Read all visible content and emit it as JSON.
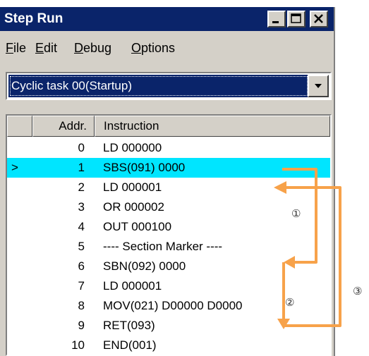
{
  "window": {
    "title": "Step Run",
    "controls": [
      "minimize",
      "maximize",
      "close"
    ]
  },
  "menu": [
    {
      "label": "File",
      "underline": "F",
      "rest": "ile"
    },
    {
      "label": "Edit",
      "underline": "E",
      "rest": "dit"
    },
    {
      "label": "Debug",
      "underline": "D",
      "rest": "ebug"
    },
    {
      "label": "Options",
      "underline": "O",
      "rest": "ptions"
    }
  ],
  "task_select": {
    "value": "Cyclic task 00(Startup)"
  },
  "list": {
    "headers": {
      "marker": "",
      "addr": "Addr.",
      "instruction": "Instruction"
    },
    "rows": [
      {
        "marker": "",
        "addr": "0",
        "instruction": "LD  000000"
      },
      {
        "marker": ">",
        "addr": "1",
        "instruction": "SBS(091)  0000"
      },
      {
        "marker": "",
        "addr": "2",
        "instruction": "LD  000001"
      },
      {
        "marker": "",
        "addr": "3",
        "instruction": "OR  000002"
      },
      {
        "marker": "",
        "addr": "4",
        "instruction": "OUT  000100"
      },
      {
        "marker": "",
        "addr": "5",
        "instruction": "---- Section Marker ----"
      },
      {
        "marker": "",
        "addr": "6",
        "instruction": "SBN(092)  0000"
      },
      {
        "marker": "",
        "addr": "7",
        "instruction": "LD  000001"
      },
      {
        "marker": "",
        "addr": "8",
        "instruction": "MOV(021)  D00000 D0000"
      },
      {
        "marker": "",
        "addr": "9",
        "instruction": "RET(093)"
      },
      {
        "marker": "",
        "addr": "10",
        "instruction": "END(001)"
      }
    ],
    "selected_row": 1
  },
  "callouts": [
    "①",
    "②",
    "③"
  ],
  "colors": {
    "arrow": "#f7a24a",
    "highlight": "#00e5ff",
    "titlebar": "#0a246a"
  }
}
